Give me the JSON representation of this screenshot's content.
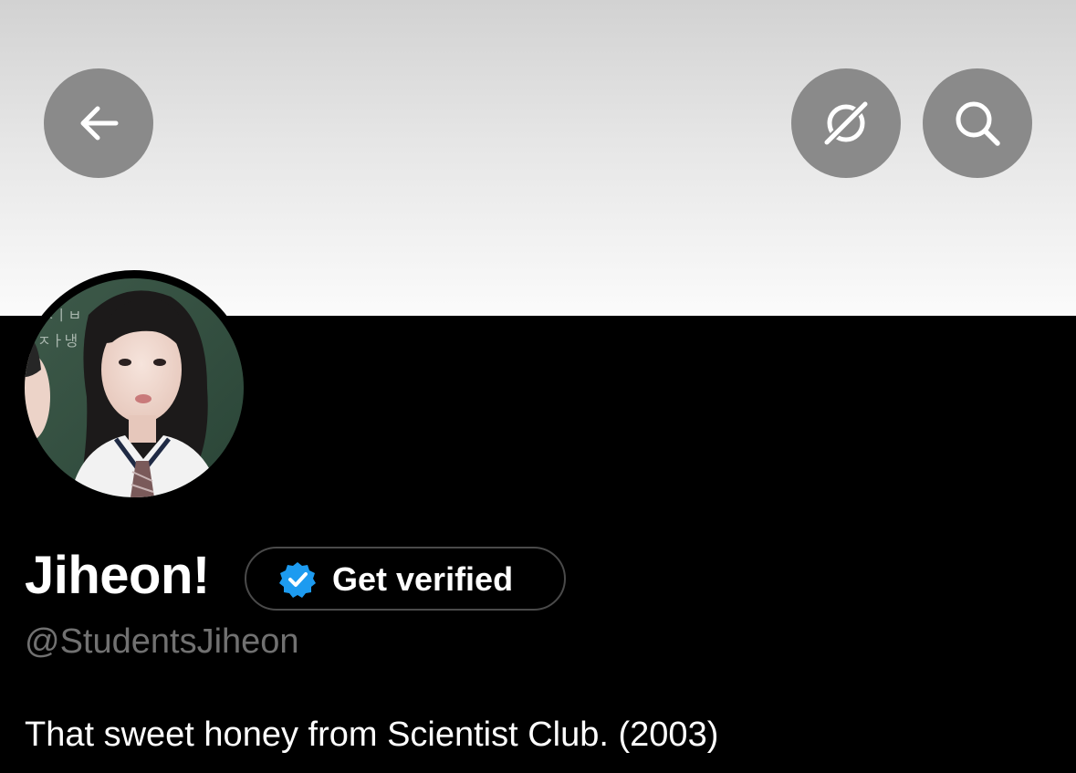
{
  "header": {
    "back_icon": "arrow-left-icon",
    "grok_icon": "grok-icon",
    "search_icon": "search-icon",
    "button_color": "#8a8a8a"
  },
  "profile": {
    "display_name": "Jiheon!",
    "verify_label": "Get verified",
    "verify_badge_color": "#1d9bf0",
    "handle": "@StudentsJiheon",
    "bio": "That sweet honey from Scientist Club. (2003)",
    "avatar_chalk_text_1": "ㅈㅣㅂ",
    "avatar_chalk_text_2": "ㅈㅏ냉"
  }
}
